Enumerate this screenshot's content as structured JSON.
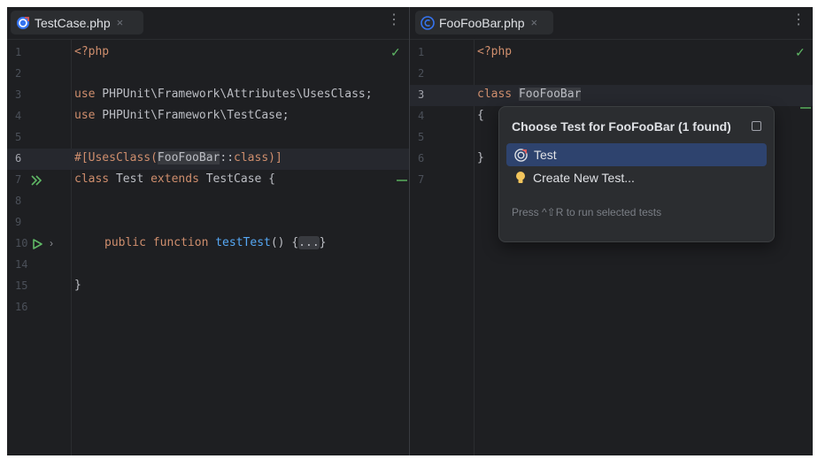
{
  "left_pane": {
    "tab": {
      "title": "TestCase.php",
      "close": "×"
    },
    "menu_glyph": "⋮",
    "lines": [
      {
        "num": "1",
        "code": "<?php"
      },
      {
        "num": "2",
        "code": ""
      },
      {
        "num": "3",
        "kw": "use",
        "rest": " PHPUnit\\Framework\\Attributes\\UsesClass;"
      },
      {
        "num": "4",
        "kw": "use",
        "rest": " PHPUnit\\Framework\\TestCase;"
      },
      {
        "num": "5",
        "code": ""
      },
      {
        "num": "6",
        "pre": "#[UsesClass(",
        "cls": "FooFooBar",
        "mid": "::",
        "kw2": "class",
        "post": ")]"
      },
      {
        "num": "7",
        "kw": "class",
        "name": " Test ",
        "kw2": "extends",
        "rest": " TestCase {"
      },
      {
        "num": "8",
        "code": ""
      },
      {
        "num": "9",
        "code": ""
      },
      {
        "num": "10",
        "kw": "public function",
        "fn": "testTest",
        "rest": "() {",
        "fold": "...",
        "close": "}"
      },
      {
        "num": "14",
        "code": ""
      },
      {
        "num": "15",
        "code": "}"
      },
      {
        "num": "16",
        "code": ""
      }
    ]
  },
  "right_pane": {
    "tab": {
      "title": "FooFooBar.php",
      "close": "×"
    },
    "menu_glyph": "⋮",
    "lines": [
      {
        "num": "1",
        "code": "<?php"
      },
      {
        "num": "2",
        "code": ""
      },
      {
        "num": "3",
        "kw": "class",
        "cls": "FooFooBar"
      },
      {
        "num": "4",
        "code": "{"
      },
      {
        "num": "5",
        "code": ""
      },
      {
        "num": "6",
        "code": "}"
      },
      {
        "num": "7",
        "code": ""
      }
    ]
  },
  "popup": {
    "title": "Choose Test for FooFooBar (1 found)",
    "items": [
      {
        "label": "Test",
        "selected": true
      },
      {
        "label": "Create New Test...",
        "selected": false
      }
    ],
    "hint": "Press ^⇧R to run selected tests"
  },
  "status": {
    "check_glyph": "✓"
  },
  "colors": {
    "editor_bg": "#1e1f22",
    "keyword": "#cf8e6d",
    "function": "#56a8f5",
    "text": "#bcbec4",
    "selection": "#2e436e",
    "run_icon": "#5fb865"
  }
}
